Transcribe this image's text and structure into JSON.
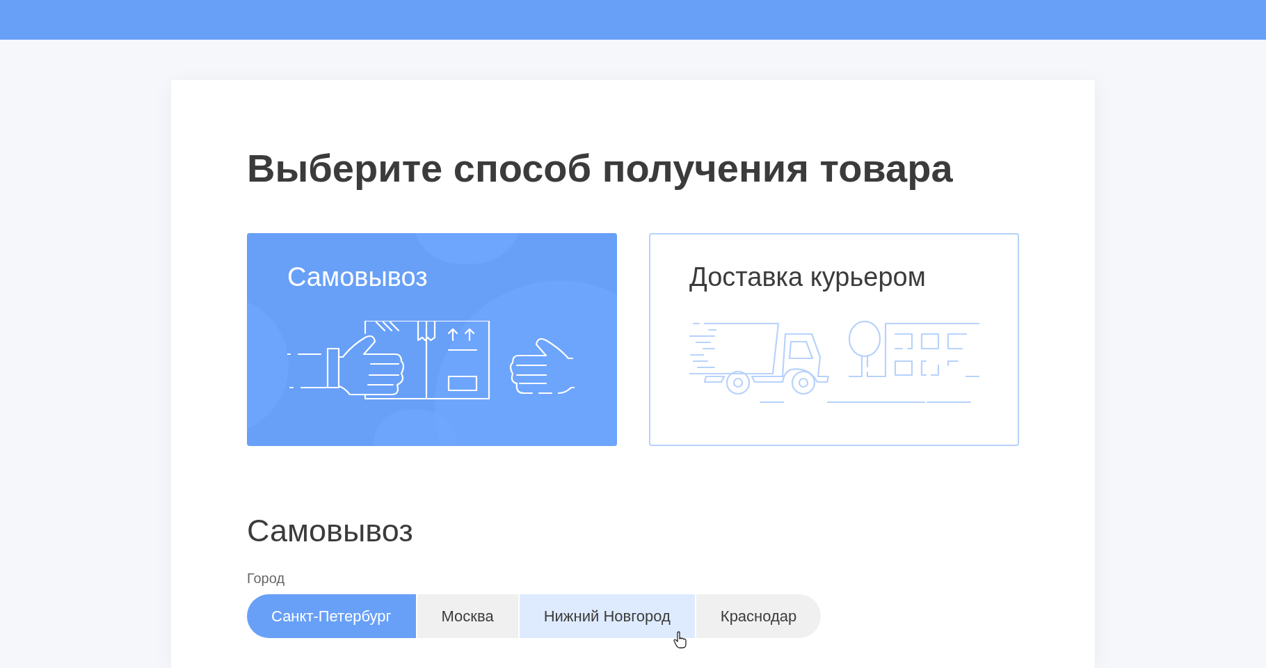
{
  "title": "Выберите способ получения товара",
  "options": [
    {
      "kind": "pickup",
      "label": "Самовывоз",
      "selected": true
    },
    {
      "kind": "courier",
      "label": "Доставка курьером",
      "selected": false
    }
  ],
  "section": {
    "heading": "Самовывоз",
    "city_label": "Город"
  },
  "cities": [
    {
      "label": "Санкт-Петербург",
      "selected": true,
      "hovered": false
    },
    {
      "label": "Москва",
      "selected": false,
      "hovered": false
    },
    {
      "label": "Нижний Новгород",
      "selected": false,
      "hovered": true
    },
    {
      "label": "Краснодар",
      "selected": false,
      "hovered": false
    }
  ]
}
